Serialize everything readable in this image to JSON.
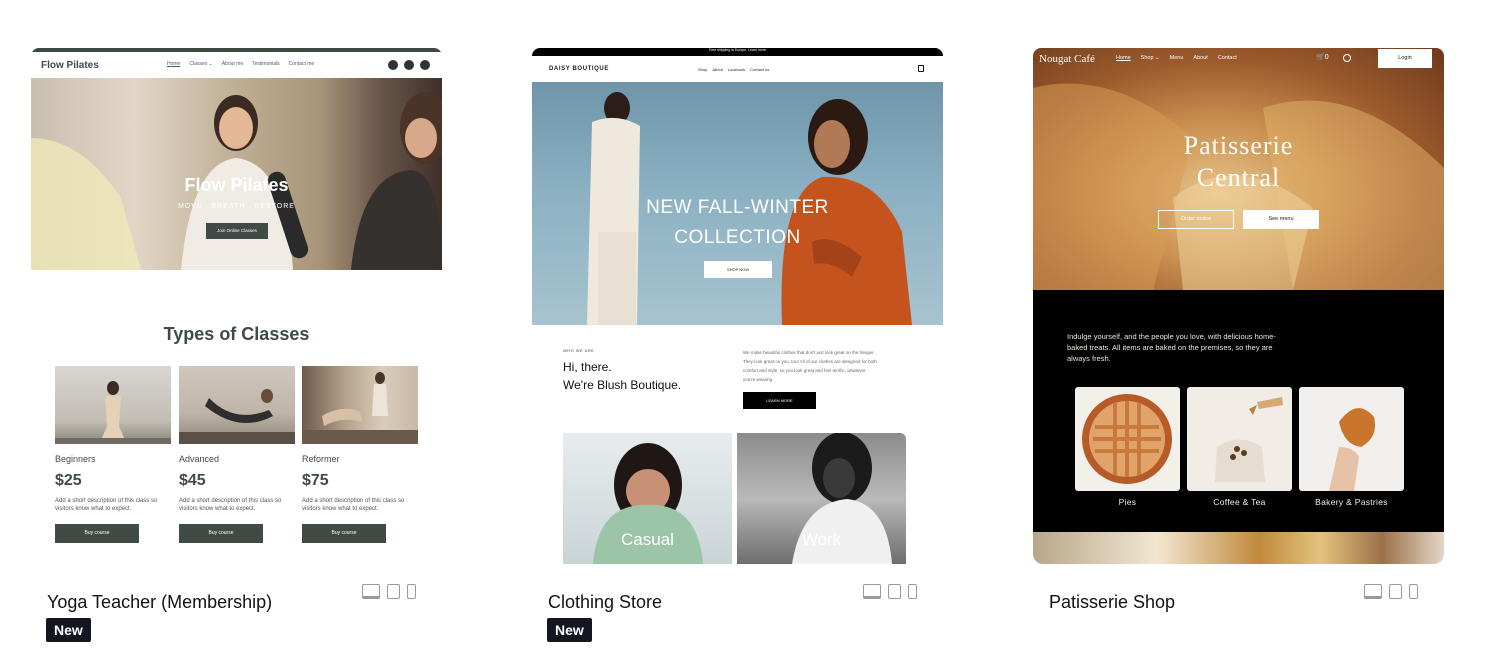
{
  "templates": [
    {
      "title": "Yoga Teacher (Membership)",
      "badge": "New",
      "preview": {
        "brand": "Flow Pilates",
        "nav": [
          "Home",
          "Classes ⌄",
          "About me",
          "Testimonials",
          "Contact me"
        ],
        "hero_title": "Flow Pilates",
        "hero_subtitle": "MOVE . BREATH . RESTORE",
        "hero_button": "Join Online Classes",
        "section_title": "Types of Classes",
        "classes": [
          {
            "name": "Beginners",
            "price": "$25",
            "desc": "Add a short description of this class so visitors know what to expect.",
            "button": "Buy course"
          },
          {
            "name": "Advanced",
            "price": "$45",
            "desc": "Add a short description of this class so visitors know what to expect.",
            "button": "Buy course"
          },
          {
            "name": "Reformer",
            "price": "$75",
            "desc": "Add a short description of this class so visitors know what to expect.",
            "button": "Buy course"
          }
        ]
      }
    },
    {
      "title": "Clothing Store",
      "badge": "New",
      "preview": {
        "announcement": "Free shipping in Europe. Learn more",
        "brand": "DAISY BOUTIQUE",
        "nav": [
          "Shop",
          "About",
          "Lookbook",
          "Contact us"
        ],
        "hero_title_1": "NEW FALL-WINTER",
        "hero_title_2": "COLLECTION",
        "hero_button": "SHOP NOW",
        "who_label": "WHO WE ARE",
        "greeting_1": "Hi, there.",
        "greeting_2": "We're Blush Boutique.",
        "about_text": "We make beautiful clothes that don't just look great on the hanger. They look great on you, too! All of our clothes are designed for both comfort and style, so you look great and feel terrific, whatever you're wearing.",
        "learn_button": "LEARN MORE",
        "tiles": [
          "Casual",
          "Work"
        ]
      }
    },
    {
      "title": "Patisserie Shop",
      "badge": "",
      "preview": {
        "brand": "Nougat Café",
        "nav": [
          "Home",
          "Shop ⌄",
          "Menu",
          "About",
          "Contact"
        ],
        "cart_count": "0",
        "login": "Login",
        "hero_title_1": "Patisserie",
        "hero_title_2": "Central",
        "button_order": "Order online",
        "button_menu": "See menu",
        "intro": "Indulge yourself, and the people you love, with delicious home-baked treats. All items are baked on the premises, so they are always fresh.",
        "categories": [
          "Pies",
          "Coffee & Tea",
          "Bakery & Pastries"
        ]
      }
    }
  ],
  "device_icons": [
    "desktop-icon",
    "tablet-icon",
    "mobile-icon"
  ]
}
